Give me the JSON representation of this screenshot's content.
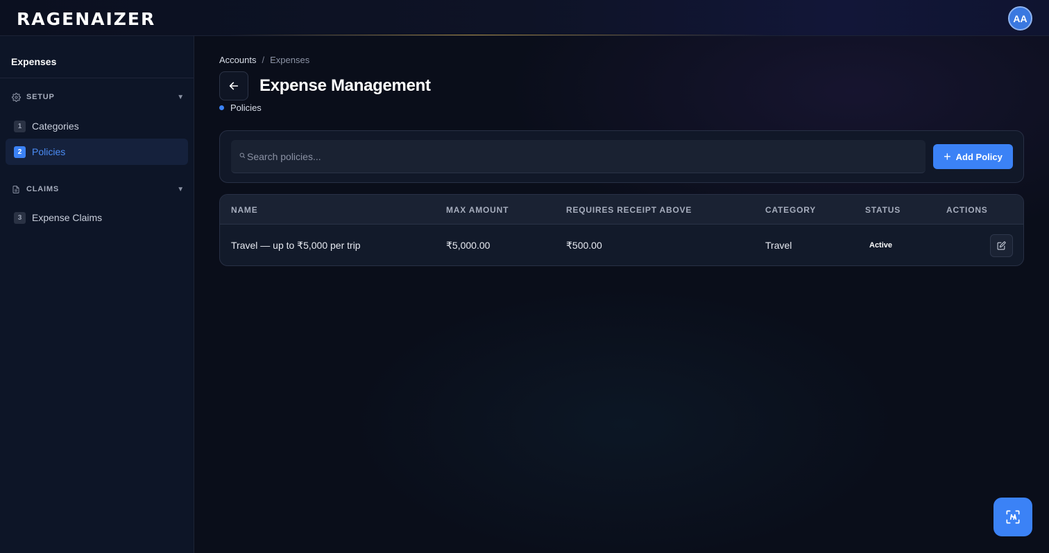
{
  "app": {
    "logo_text": "RAGENAIZER",
    "avatar_initials": "AA"
  },
  "sidebar": {
    "title": "Expenses",
    "sections": [
      {
        "label": "SETUP",
        "icon": "gear-icon",
        "items": [
          {
            "number": "1",
            "label": "Categories",
            "active": false
          },
          {
            "number": "2",
            "label": "Policies",
            "active": true
          }
        ]
      },
      {
        "label": "CLAIMS",
        "icon": "document-icon",
        "items": [
          {
            "number": "3",
            "label": "Expense Claims",
            "active": false
          }
        ]
      }
    ]
  },
  "breadcrumb": {
    "items": [
      "Accounts",
      "Expenses"
    ],
    "separator": "/"
  },
  "page": {
    "title": "Expense Management",
    "sub_label": "Policies"
  },
  "search": {
    "placeholder": "Search policies...",
    "value": ""
  },
  "toolbar": {
    "add_label": "Add Policy"
  },
  "table": {
    "columns": [
      "NAME",
      "MAX AMOUNT",
      "REQUIRES RECEIPT ABOVE",
      "CATEGORY",
      "STATUS",
      "ACTIONS"
    ],
    "rows": [
      {
        "name": "Travel — up to ₹5,000 per trip",
        "max_amount": "₹5,000.00",
        "receipt_above": "₹500.00",
        "category": "Travel",
        "status": "Active"
      }
    ]
  },
  "colors": {
    "accent": "#3b82f6",
    "background": "#0a0e1a",
    "sidebar": "#0d1527"
  }
}
